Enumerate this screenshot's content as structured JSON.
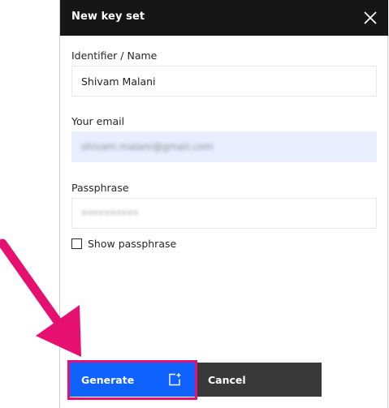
{
  "modal": {
    "title": "New key set"
  },
  "fields": {
    "identifier": {
      "label": "Identifier / Name",
      "value": "Shivam Malani"
    },
    "email": {
      "label": "Your email",
      "blurred_value": "shivam.malani@gmail.com"
    },
    "passphrase": {
      "label": "Passphrase",
      "blurred_value": "••••••••••"
    }
  },
  "checkbox": {
    "label": "Show passphrase",
    "checked": false
  },
  "buttons": {
    "generate": "Generate",
    "cancel": "Cancel"
  },
  "icons": {
    "close": "close-icon",
    "generate": "add-key-icon",
    "pointer": "arrow-pointer-icon"
  },
  "colors": {
    "header_bg": "#161616",
    "primary": "#0f62fe",
    "secondary": "#393939",
    "highlight": "#e5106f",
    "email_field_bg": "#e9efff"
  }
}
